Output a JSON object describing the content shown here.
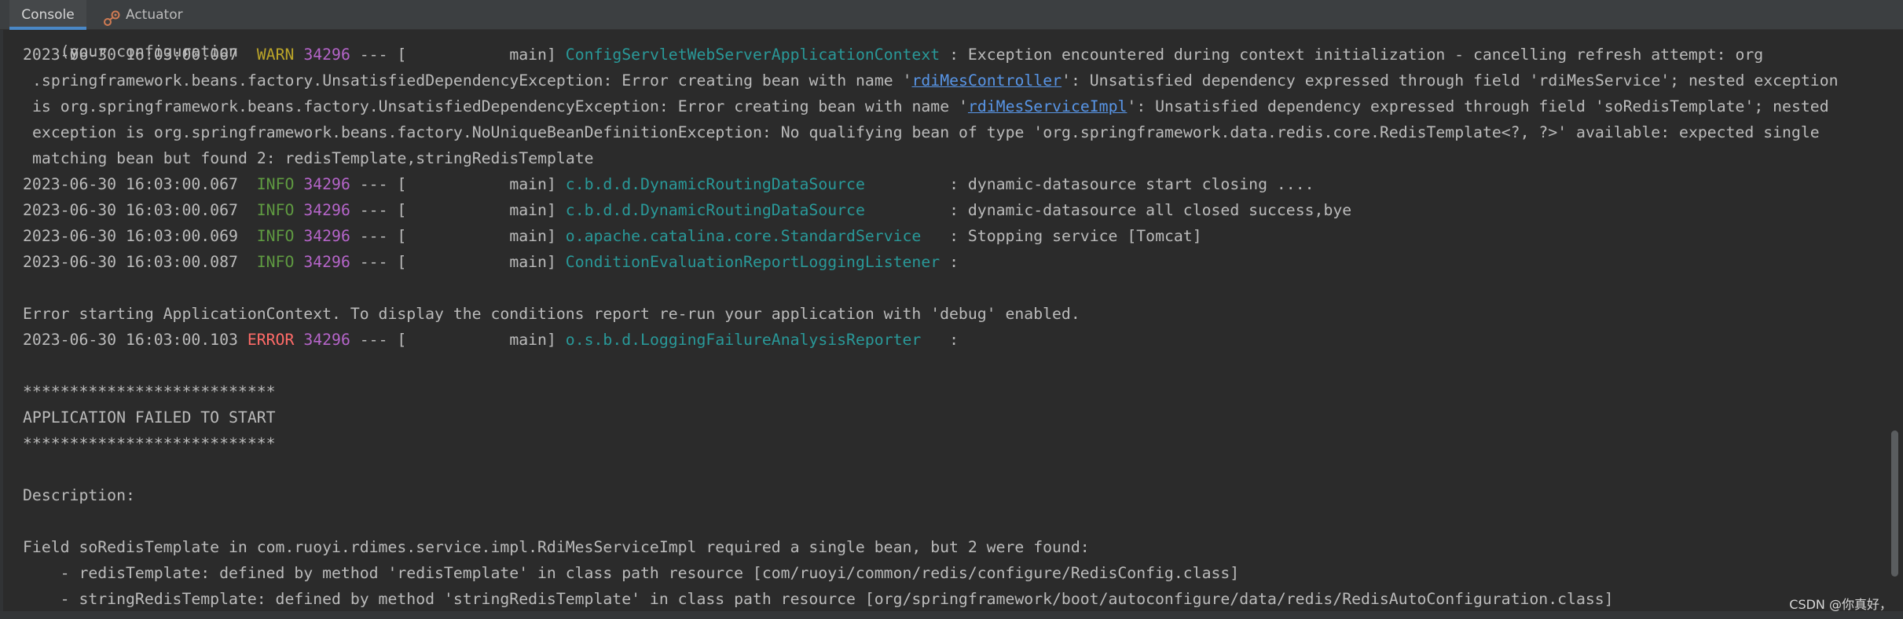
{
  "tabs": [
    {
      "label": "Console",
      "active": true
    },
    {
      "label": "Actuator",
      "active": false,
      "icon": "actuator-icon"
    }
  ],
  "colors": {
    "background": "#2b2b2b",
    "warn": "#bba529",
    "info": "#5f9a41",
    "error": "#ff6b68",
    "pid": "#b565c9",
    "logger": "#299999",
    "link": "#5895e6"
  },
  "console": {
    "top_partial": "(your configuration",
    "log1": {
      "timestamp": "2023-06-30 16:03:00.067",
      "level": " WARN",
      "pid": "34296",
      "sep": " --- [           main] ",
      "logger": "ConfigServletWebServerApplicationContext",
      "message": " : Exception encountered during context initialization - cancelling refresh attempt: org"
    },
    "log1_cont": {
      "l1_a": ".springframework.beans.factory.UnsatisfiedDependencyException: Error creating bean with name '",
      "l1_link": "rdiMesController",
      "l1_b": "': Unsatisfied dependency expressed through field 'rdiMesService'; nested exception",
      "l2_a": "is org.springframework.beans.factory.UnsatisfiedDependencyException: Error creating bean with name '",
      "l2_link": "rdiMesServiceImpl",
      "l2_b": "': Unsatisfied dependency expressed through field 'soRedisTemplate'; nested",
      "l3": "exception is org.springframework.beans.factory.NoUniqueBeanDefinitionException: No qualifying bean of type 'org.springframework.data.redis.core.RedisTemplate<?, ?>' available: expected single",
      "l4": "matching bean but found 2: redisTemplate,stringRedisTemplate"
    },
    "log2": {
      "timestamp": "2023-06-30 16:03:00.067",
      "level": " INFO",
      "pid": "34296",
      "sep": " --- [           main] ",
      "logger": "c.b.d.d.DynamicRoutingDataSource        ",
      "message": " : dynamic-datasource start closing ...."
    },
    "log3": {
      "timestamp": "2023-06-30 16:03:00.067",
      "level": " INFO",
      "pid": "34296",
      "sep": " --- [           main] ",
      "logger": "c.b.d.d.DynamicRoutingDataSource        ",
      "message": " : dynamic-datasource all closed success,bye"
    },
    "log4": {
      "timestamp": "2023-06-30 16:03:00.069",
      "level": " INFO",
      "pid": "34296",
      "sep": " --- [           main] ",
      "logger": "o.apache.catalina.core.StandardService  ",
      "message": " : Stopping service [Tomcat]"
    },
    "log5": {
      "timestamp": "2023-06-30 16:03:00.087",
      "level": " INFO",
      "pid": "34296",
      "sep": " --- [           main] ",
      "logger": "ConditionEvaluationReportLoggingListener",
      "message": " :"
    },
    "error_context": "Error starting ApplicationContext. To display the conditions report re-run your application with 'debug' enabled.",
    "log6": {
      "timestamp": "2023-06-30 16:03:00.103",
      "level": " ERROR",
      "pid": "34296",
      "sep": " --- [           main] ",
      "logger": "o.s.b.d.LoggingFailureAnalysisReporter  ",
      "message": " :"
    },
    "stars1": "***************************",
    "failed": "APPLICATION FAILED TO START",
    "stars2": "***************************",
    "description_label": "Description:",
    "field_line": "Field soRedisTemplate in com.ruoyi.rdimes.service.impl.RdiMesServiceImpl required a single bean, but 2 were found:",
    "bean1": "    - redisTemplate: defined by method 'redisTemplate' in class path resource [com/ruoyi/common/redis/configure/RedisConfig.class]",
    "bean2": "    - stringRedisTemplate: defined by method 'stringRedisTemplate' in class path resource [org/springframework/boot/autoconfigure/data/redis/RedisAutoConfiguration.class]"
  },
  "watermark": "CSDN @你真好，"
}
